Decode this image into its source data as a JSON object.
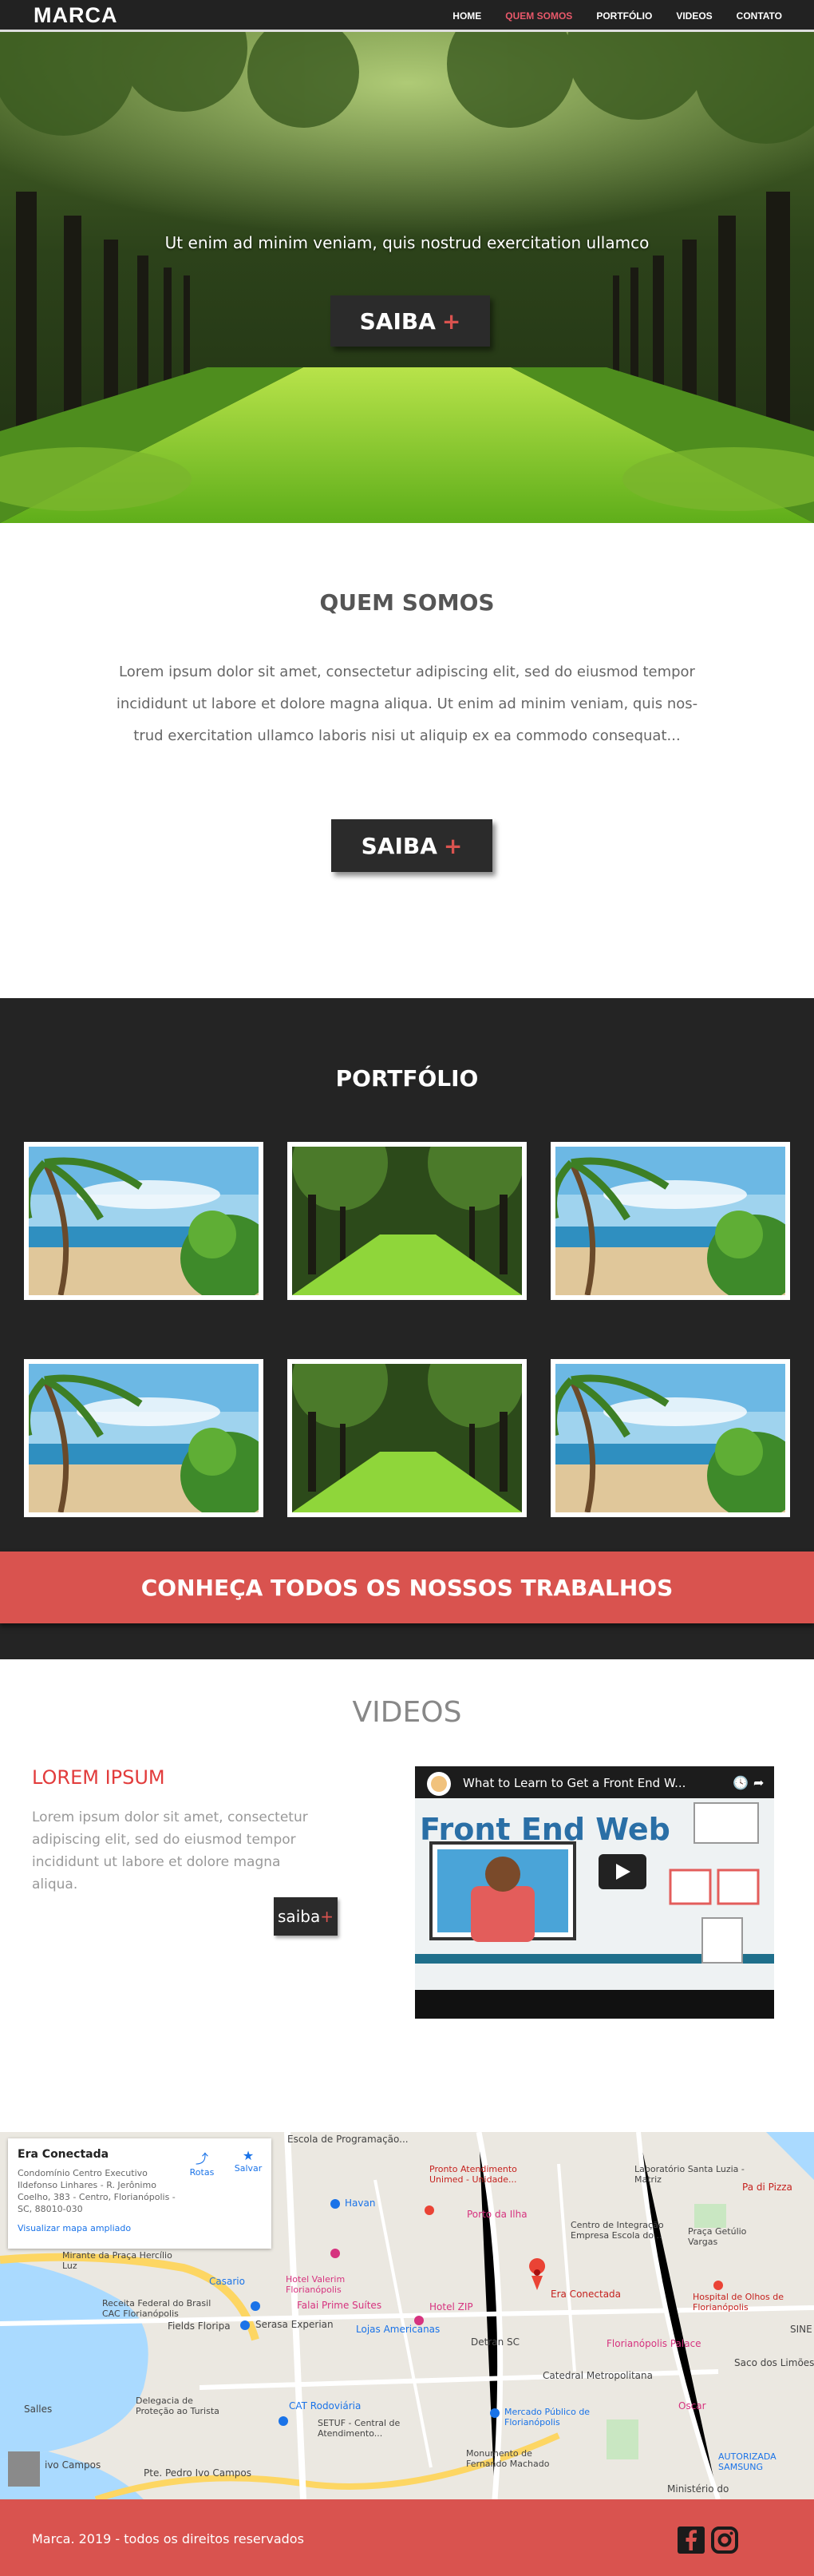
{
  "nav": {
    "brand": "MARCA",
    "items": [
      {
        "label": "HOME"
      },
      {
        "label": "QUEM SOMOS"
      },
      {
        "label": "PORTFÓLIO"
      },
      {
        "label": "VIDEOS"
      },
      {
        "label": "CONTATO"
      }
    ]
  },
  "hero": {
    "tagline": "Ut enim ad minim veniam, quis nostrud exercitation ullamco",
    "button_label": "SAIBA",
    "button_plus": "+"
  },
  "about": {
    "title": "QUEM SOMOS",
    "text": "Lorem ipsum dolor sit amet, consectetur adipiscing elit, sed do eiusmod tempor incididunt ut labore et dolore magna aliqua. Ut enim ad minim veniam, quis nos- trud exercitation ullamco laboris nisi ut aliquip ex ea commodo consequat...",
    "button_label": "SAIBA",
    "button_plus": "+"
  },
  "portfolio": {
    "title": "PORTFÓLIO",
    "cta": "CONHEÇA TODOS OS NOSSOS TRABALHOS"
  },
  "videos": {
    "title": "VIDEOS",
    "lorem_title": "LOREM IPSUM",
    "lorem_text": "Lorem ipsum dolor sit amet, consectetur adipiscing elit, sed do eiusmod tempor incididunt ut labore et dolore magna aliqua.",
    "button_label": "saiba",
    "button_plus": "+",
    "video_title": "What to Learn to Get a Front End W...",
    "video_banner": "Front End Web"
  },
  "map": {
    "card_name": "Era Conectada",
    "card_address": "Condomínio Centro Executivo Ildefonso Linhares - R. Jerônimo Coelho, 383 - Centro, Florianópolis - SC, 88010-030",
    "card_link": "Visualizar mapa ampliado",
    "card_route": "Rotas",
    "card_save": "Salvar",
    "labels": {
      "escola": "Escola de Programação...",
      "pronto": "Pronto Atendimento Unimed - Unidade...",
      "laboratorio": "Laboratório Santa Luzia - Matriz",
      "padi": "Pa di Pizza",
      "havan": "Havan",
      "porto": "Porto da Ilha",
      "centro_integracao": "Centro de Integração Empresa Escola do...",
      "praca_getulio": "Praça Getúlio Vargas",
      "mirante": "Mirante da Praça Hercílio Luz",
      "casario": "Casario",
      "hotel_valerim": "Hotel Valerim Florianópolis",
      "era": "Era Conectada",
      "hospital": "Hospital de Olhos de Florianópolis",
      "receita": "Receita Federal do Brasil CAC Florianópolis",
      "falai": "Falai Prime Suítes",
      "hotel_zip": "Hotel ZIP",
      "fields": "Fields Floripa",
      "serasa": "Serasa Experian",
      "lojas": "Lojas Americanas",
      "detran": "Detran SC",
      "floripa_palace": "Florianópolis Palace",
      "catedral": "Catedral Metropolitana",
      "delegacia": "Delegacia de Proteção ao Turista",
      "cat": "CAT Rodoviária",
      "setuf": "SETUF - Central de Atendimento...",
      "mercado": "Mercado Público de Florianópolis",
      "oscar": "Oscar",
      "autorizada": "AUTORIZADA SAMSUNG",
      "monumento": "Monumento de Fernando Machado",
      "ministerio": "Ministério do",
      "saco": "Saco dos Limões",
      "pte": "Pte. Pedro Ivo Campos",
      "campos": "ivo Campos",
      "salles": "Salles",
      "sine": "SINE"
    }
  },
  "footer": {
    "text": "Marca. 2019 - todos os direitos reservados"
  },
  "colors": {
    "dark": "#222222",
    "accent_red": "#d9534f",
    "nav_active": "#e8586a"
  }
}
